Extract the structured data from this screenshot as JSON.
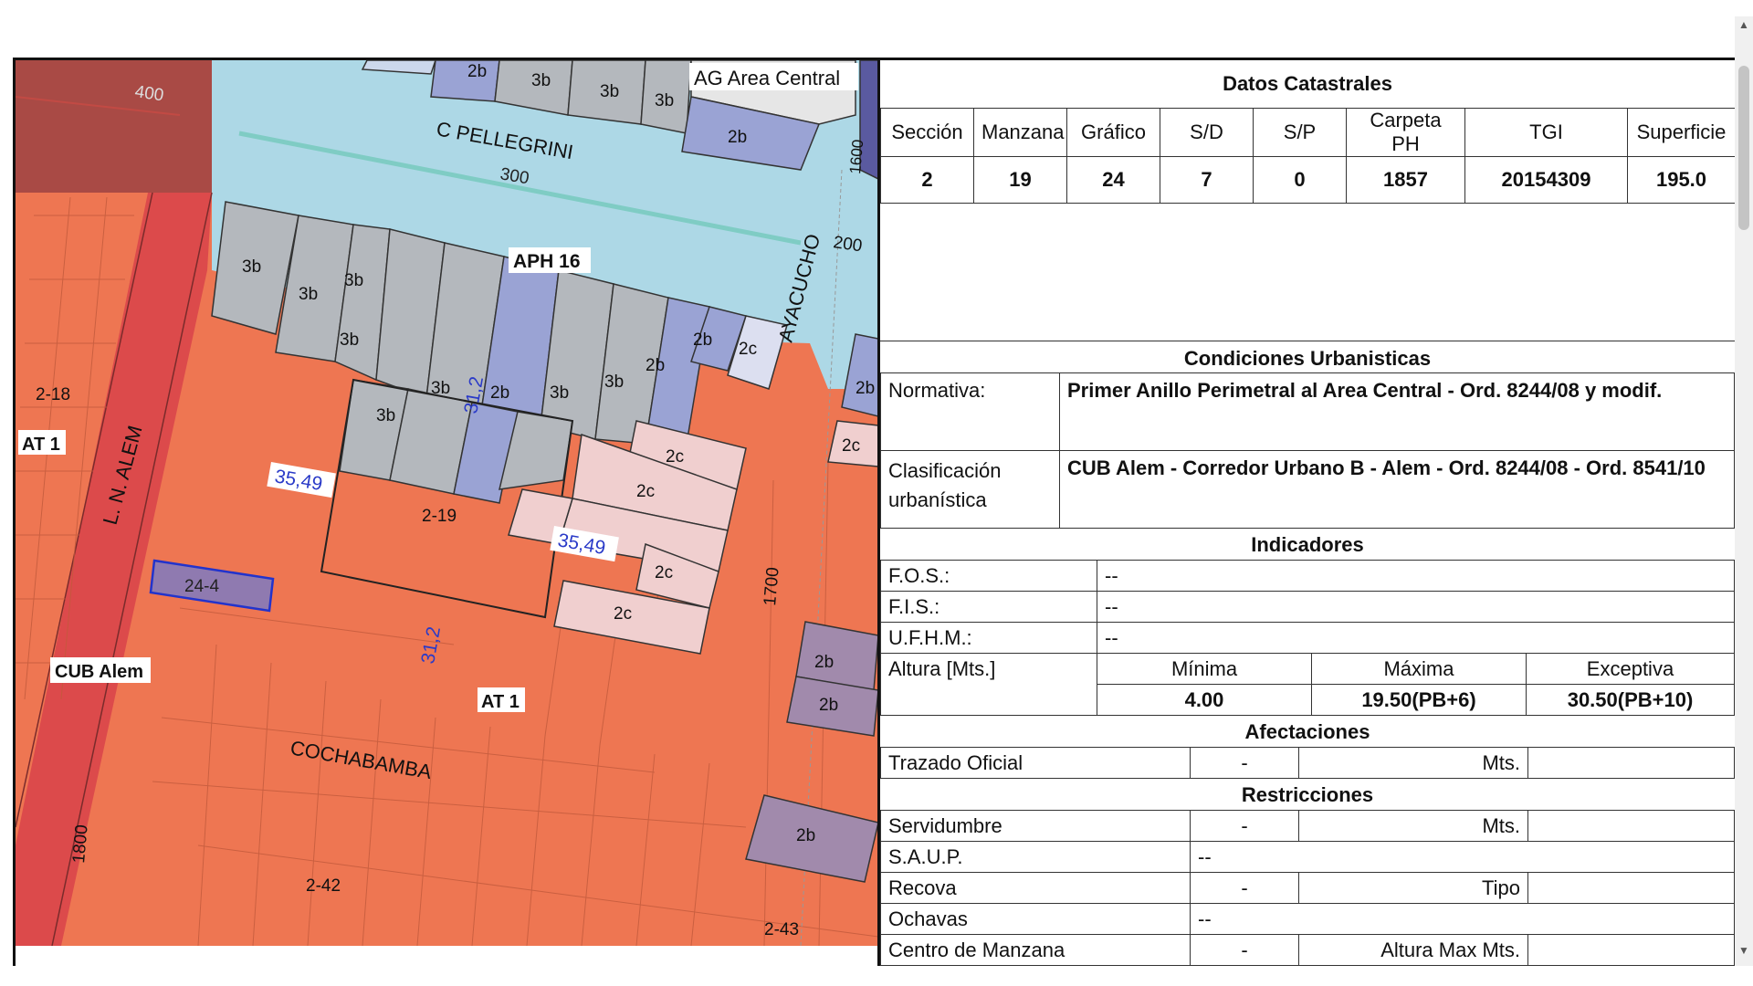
{
  "map": {
    "labels": {
      "ag_area_central": "AG Area Central",
      "c_pellegrini": "C PELLEGRINI",
      "aph16": "APH 16",
      "ayacucho": "AYACUCHO",
      "alem": "L. N. ALEM",
      "cub_alem": "CUB Alem",
      "at1_left": "AT 1",
      "at1_center": "AT 1",
      "cochabamba": "COCHABAMBA",
      "parcel_selected": "24-4",
      "n400": "400",
      "n300": "300",
      "n1600": "1600",
      "n200": "200",
      "n1700": "1700",
      "n1800": "1800",
      "d3549a": "35,49",
      "d3549b": "35,49",
      "d312a": "31,2",
      "d312b": "31,2",
      "z218": "2-18",
      "z219": "2-19",
      "z242": "2-42",
      "z243": "2-43"
    },
    "colors": {
      "zone_orange": "#ee7652",
      "zone_red": "#dc4a4b",
      "zone_maroon": "#a94a45",
      "zone_lightblue": "#add8e6",
      "block_gray": "#b4b8bd",
      "block_blue": "#9aa3d4",
      "block_pink": "#f0cfcf",
      "block_purple": "#a18aac",
      "selected_parcel": "#8f7ab0"
    }
  },
  "panel": {
    "datos_title": "Datos Catastrales",
    "headers": [
      "Sección",
      "Manzana",
      "Gráfico",
      "S/D",
      "S/P",
      "Carpeta PH",
      "TGI",
      "Superficie"
    ],
    "values": [
      "2",
      "19",
      "24",
      "7",
      "0",
      "1857",
      "20154309",
      "195.0"
    ],
    "condiciones_title": "Condiciones Urbanisticas",
    "normativa_label": "Normativa:",
    "normativa_value": "Primer Anillo Perimetral al Area Central - Ord. 8244/08 y modif.",
    "clasificacion_label": "Clasificación urbanística",
    "clasificacion_value": "CUB Alem - Corredor Urbano B - Alem - Ord. 8244/08 - Ord. 8541/10",
    "indicadores_title": "Indicadores",
    "fos_label": "F.O.S.:",
    "fos_value": "--",
    "fis_label": "F.I.S.:",
    "fis_value": "--",
    "ufhm_label": "U.F.H.M.:",
    "ufhm_value": "--",
    "altura_label": "Altura [Mts.]",
    "altura_minima_label": "Mínima",
    "altura_maxima_label": "Máxima",
    "altura_excepcional_label": "Exceptiva",
    "altura_minima_value": "4.00",
    "altura_maxima_value": "19.50(PB+6)",
    "altura_excepcional_value": "30.50(PB+10)",
    "afectaciones_title": "Afectaciones",
    "trazado_label": "Trazado Oficial",
    "trazado_value": "-",
    "trazado_unit": "Mts.",
    "restricciones_title": "Restricciones",
    "servidumbre_label": "Servidumbre",
    "servidumbre_value": "-",
    "servidumbre_unit": "Mts.",
    "saup_label": "S.A.U.P.",
    "saup_value": "--",
    "recova_label": "Recova",
    "recova_value": "-",
    "recova_unit": "Tipo",
    "ochavas_label": "Ochavas",
    "ochavas_value": "--",
    "centro_label": "Centro de Manzana",
    "centro_value": "-",
    "centro_unit": "Altura Max Mts."
  }
}
